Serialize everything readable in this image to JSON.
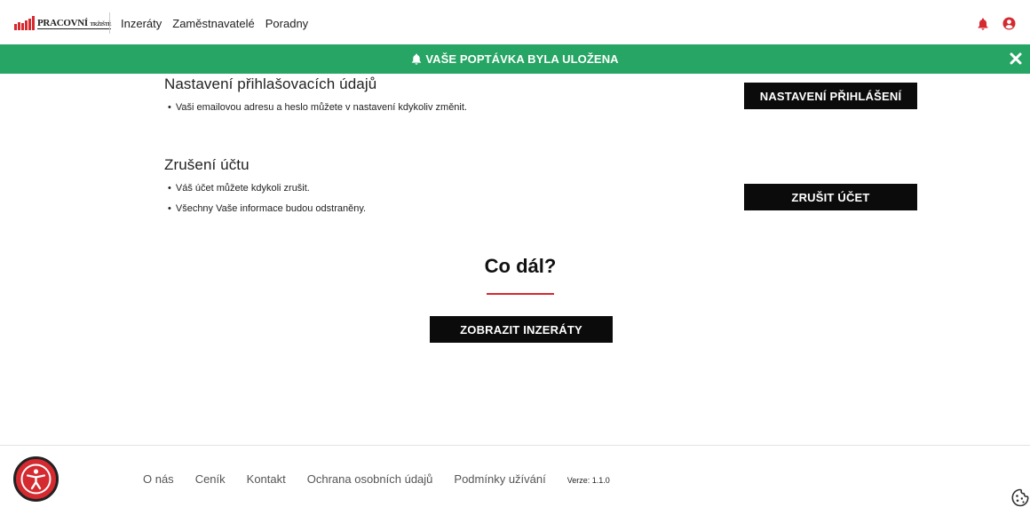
{
  "header": {
    "logo_text": "PRACOVNÍ",
    "logo_subtext": "TRŽIŠTĚ",
    "nav": [
      "Inzeráty",
      "Zaměstnavatelé",
      "Poradny"
    ],
    "icons": [
      "bell-icon",
      "user-circle-icon"
    ]
  },
  "banner": {
    "message": "VAŠE POPTÁVKA BYLA ULOŽENA",
    "icon": "bell-icon",
    "color": "#27a564"
  },
  "login_settings": {
    "title": "Nastavení přihlašovacích údajů",
    "bullets": [
      "Vaši emailovou adresu a heslo můžete v nastavení kdykoliv změnit."
    ],
    "button": "NASTAVENÍ PŘIHLÁŠENÍ"
  },
  "cancel_account": {
    "title": "Zrušení účtu",
    "bullets": [
      "Váš účet můžete kdykoli zrušit.",
      "Všechny Vaše informace budou odstraněny."
    ],
    "button": "ZRUŠIT ÚČET"
  },
  "next": {
    "title": "Co dál?",
    "button": "ZOBRAZIT INZERÁTY",
    "accent": "#d42a30"
  },
  "footer": {
    "links": [
      "O nás",
      "Ceník",
      "Kontakt",
      "Ochrana osobních údajů",
      "Podmínky užívání"
    ],
    "version": "Verze: 1.1.0",
    "icons": [
      "accessibility-icon",
      "cookie-icon"
    ]
  }
}
